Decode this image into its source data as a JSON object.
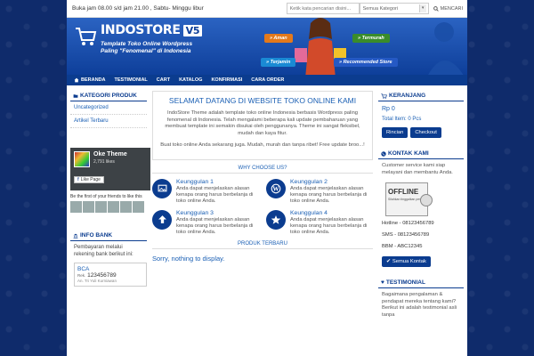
{
  "topbar": {
    "hours": "Buka jam 08.00 s/d jam 21.00 , Sabtu- Minggu libur",
    "search_placeholder": "Ketik kata pencarian disini...",
    "category": "Semua Kategori",
    "search_button": "MENCARI"
  },
  "banner": {
    "title": "INDOSTORE",
    "version": "V5",
    "tagline_line1": "Template Toko Online Wordpress",
    "tagline_line2": "Paling \"Fenomenal\" di Indonesia",
    "pills": [
      "» Aman",
      "» Termurah",
      "» Terjamin",
      "» Recommended Store"
    ]
  },
  "nav": {
    "items": [
      "BERANDA",
      "TESTIMONIAL",
      "CART",
      "KATALOG",
      "KONFIRMASI",
      "CARA ORDER"
    ]
  },
  "left": {
    "kategori_title": "KATEGORI PRODUK",
    "kategori_items": [
      "Uncategorized",
      "Artikel Terbaru"
    ],
    "fb": {
      "name": "Oke Theme",
      "likes": "2,791 likes",
      "like_button": "Like Page",
      "first": "Be the first of your friends to like this"
    },
    "bank_title": "INFO BANK",
    "bank_desc": "Pembayaran melalui rekening bank berikut ini:",
    "bank": {
      "name": "BCA",
      "rek_label": "Rek.",
      "rek": "123456789",
      "owner": "An. Tri Yuli Kurniawan"
    }
  },
  "main": {
    "welcome_title": "SELAMAT DATANG DI WEBSITE TOKO ONLINE KAMI",
    "welcome_p1": "IndoStore Theme adalah template toko online Indonesia berbasis Wordpress paling fenomenal di Indonesia. Telah mengalami beberapa kali update pembaharuan yang membuat template ini semakin disukai oleh penggunanya. Theme ini sangat fleksibel, mudah dan kaya fitur.",
    "welcome_p2": "Buat toko online Anda sekarang juga. Mudah, murah dan tanpa ribet! Free update broo...!",
    "why_title": "WHY CHOOSE US?",
    "features": [
      {
        "title": "Keunggulan 1",
        "text": "Anda dapat menjelaskan alasan kenapa orang harus berbelanja di toko online Anda.",
        "icon": "image-icon"
      },
      {
        "title": "Keunggulan 2",
        "text": "Anda dapat menjelaskan alasan kenapa orang harus berbelanja di toko online Anda.",
        "icon": "wordpress-icon"
      },
      {
        "title": "Keunggulan 3",
        "text": "Anda dapat menjelaskan alasan kenapa orang harus berbelanja di toko online Anda.",
        "icon": "arrow-up-icon"
      },
      {
        "title": "Keunggulan 4",
        "text": "Anda dapat menjelaskan alasan kenapa orang harus berbelanja di toko online Anda.",
        "icon": "star-icon"
      }
    ],
    "produk_title": "PRODUK TERBARU",
    "sorry": "Sorry, nothing to display."
  },
  "right": {
    "cart_title": "KERANJANG",
    "cart_total": "Rp 0",
    "cart_count": "Total Item: 0 Pcs",
    "rincian": "Rincian",
    "checkout": "Checkout",
    "kontak_title": "KONTAK KAMI",
    "cs_text": "Customer service kami siap melayani dan membantu Anda.",
    "offline_label": "OFFLINE",
    "offline_sub": "Silahkan tinggalkan pesan",
    "hotline": "Hotline - 08123456789",
    "sms": "SMS - 08123456789",
    "bbm": "BBM - ABC12345",
    "semua_kontak": "Semua Kontak",
    "testi_title": "TESTIMONIAL",
    "testi_text": "Bagaimana pengalaman & pendapat mereka tentang kami? Berikut ini adalah testimonial asli tanpa"
  },
  "colors": {
    "brand_dark": "#0b3c8f",
    "link": "#1a5fb4"
  }
}
